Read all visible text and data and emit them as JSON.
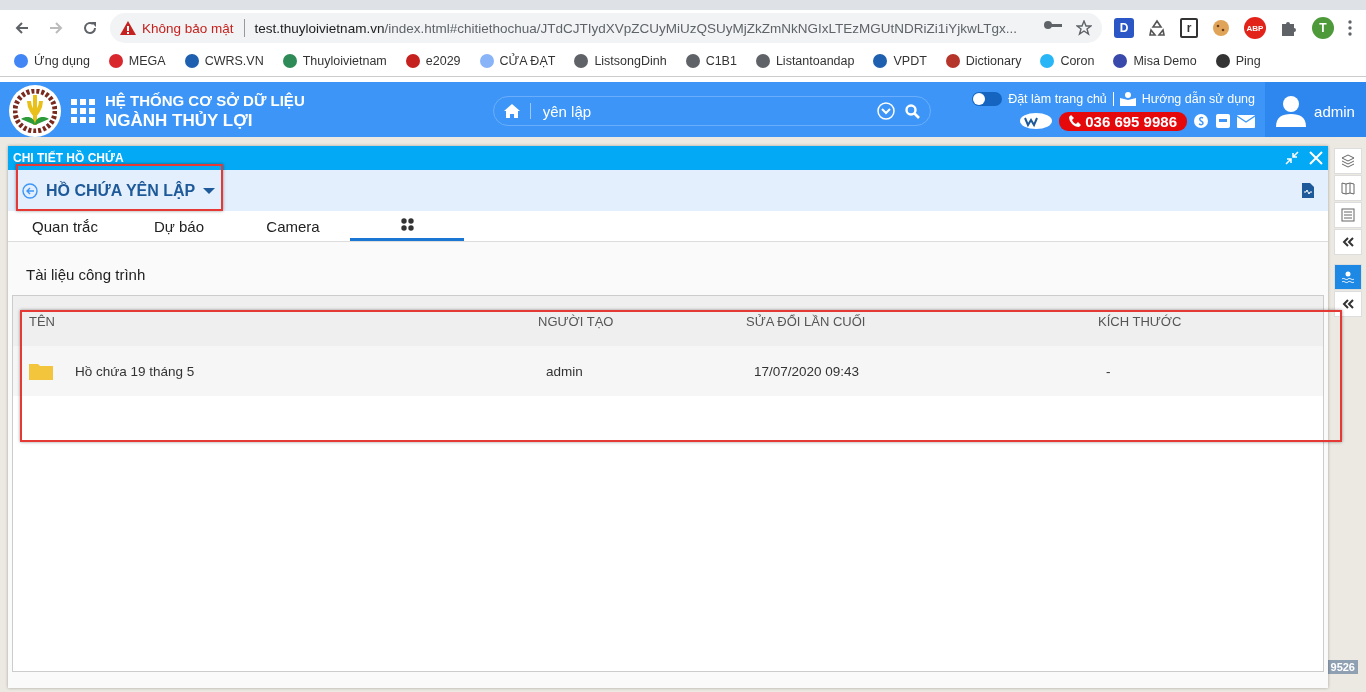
{
  "browser": {
    "security_label": "Không bảo mật",
    "url_host": "test.thuyloivietnam.vn",
    "url_path": "/index.html#chitiethochua/JTdCJTIydXVpZCUyMiUzQSUyMjZkZmNkNGIxLTEzMGUtNDRiZi1iYjkwLTgx...",
    "extensions": [
      {
        "kind": "letter",
        "label": "D"
      },
      {
        "kind": "recycle"
      },
      {
        "kind": "letter-outline",
        "label": "r"
      },
      {
        "kind": "cookie"
      },
      {
        "kind": "abp",
        "label": "ABP"
      },
      {
        "kind": "puzzle"
      },
      {
        "kind": "profile",
        "label": "T"
      }
    ],
    "bookmarks": [
      {
        "label": "Ứng dụng",
        "color": "#4285f4"
      },
      {
        "label": "MEGA",
        "color": "#d9272e"
      },
      {
        "label": "CWRS.VN",
        "color": "#1f5fb0"
      },
      {
        "label": "Thuyloivietnam",
        "color": "#2e8b57"
      },
      {
        "label": "e2029",
        "color": "#c5221f"
      },
      {
        "label": "CỬA ĐẠT",
        "color": "#8ab4f8"
      },
      {
        "label": "ListsongDinh",
        "color": "#5f6368"
      },
      {
        "label": "C1B1",
        "color": "#5f6368"
      },
      {
        "label": "Listantoandap",
        "color": "#5f6368"
      },
      {
        "label": "VPDT",
        "color": "#1f5fb0"
      },
      {
        "label": "Dictionary",
        "color": "#b5352b"
      },
      {
        "label": "Coron",
        "color": "#29b6f6"
      },
      {
        "label": "Misa Demo",
        "color": "#3949ab"
      },
      {
        "label": "Ping",
        "color": "#333333"
      }
    ]
  },
  "header": {
    "title_line1": "HỆ THỐNG CƠ SỞ DỮ LIỆU",
    "title_line2": "NGÀNH THỦY LỢI",
    "search": {
      "value": "yên lập"
    },
    "homepage_toggle": {
      "label": "Đặt làm trang chủ",
      "on": false
    },
    "guide_link": "Hướng dẫn sử dụng",
    "hotline": "036 695 9986",
    "user": "admin"
  },
  "panel": {
    "title": "CHI TIẾT HỒ CHỨA",
    "reservoir": "HỒ CHỨA YÊN LẬP",
    "tabs": [
      {
        "kind": "text",
        "label": "Quan trắc",
        "selected": false
      },
      {
        "kind": "text",
        "label": "Dự báo",
        "selected": false
      },
      {
        "kind": "text",
        "label": "Camera",
        "selected": false
      },
      {
        "kind": "icon",
        "selected": true
      }
    ],
    "section_title": "Tài liệu công trình",
    "table": {
      "columns": [
        "TÊN",
        "NGƯỜI TẠO",
        "SỬA ĐỔI LẦN CUỐI",
        "KÍCH THƯỚC"
      ],
      "rows": [
        {
          "kind": "folder",
          "name": "Hồ chứa 19 tháng 5",
          "creator": "admin",
          "modified": "17/07/2020 09:43",
          "size": "-"
        }
      ]
    }
  },
  "map": {
    "scale_label": "9526"
  }
}
